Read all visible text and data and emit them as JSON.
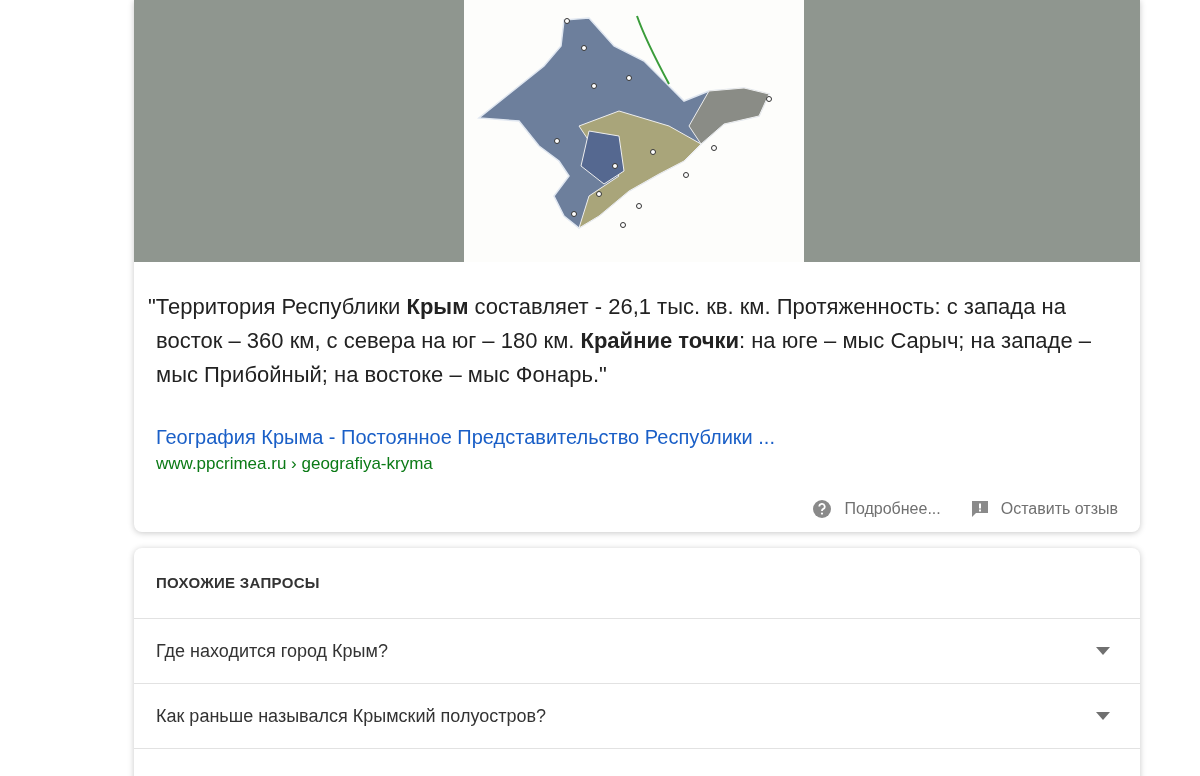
{
  "snippet": {
    "quote": "\"Территория Республики **Крым** составляет - 26,1 тыс. кв. км. Протяженность: с запада на восток – 360 км, с севера на юг – 180 км. **Крайние точки**: на юге – мыс Сарыч; на западе – мыс Прибойный; на востоке – мыс Фонарь.\"",
    "link_title": "География Крыма - Постоянное Представительство Республики ...",
    "url": "www.ppcrimea.ru › geografiya-kryma",
    "footer": [
      {
        "kind": "help",
        "label": "Подробнее..."
      },
      {
        "kind": "feedback",
        "label": "Оставить отзыв"
      }
    ]
  },
  "related": {
    "heading": "ПОХОЖИЕ ЗАПРОСЫ",
    "questions": [
      {
        "text": "Где находится город Крым?",
        "expanded": false
      },
      {
        "text": "Как раньше назывался Крымский полуостров?",
        "expanded": false
      }
    ]
  }
}
